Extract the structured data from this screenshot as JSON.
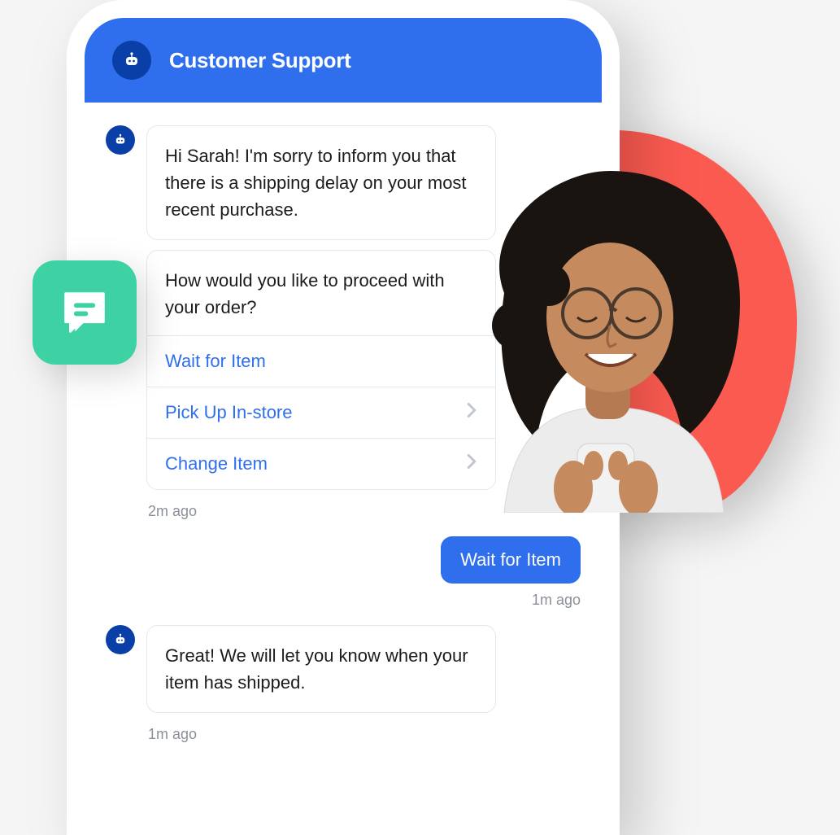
{
  "header": {
    "title": "Customer Support"
  },
  "messages": [
    {
      "from": "bot",
      "text": "Hi Sarah! I'm sorry to inform you that there is a shipping delay on your most recent purchase."
    },
    {
      "from": "bot",
      "question": "How would you like to proceed with your order?",
      "options": [
        {
          "label": "Wait for Item",
          "chevron": false
        },
        {
          "label": "Pick Up In-store",
          "chevron": true
        },
        {
          "label": "Change Item",
          "chevron": true
        }
      ],
      "timestamp": "2m ago"
    },
    {
      "from": "user",
      "text": "Wait for Item",
      "timestamp": "1m ago"
    },
    {
      "from": "bot",
      "text": "Great! We will let you know when your item has shipped.",
      "timestamp": "1m ago"
    }
  ]
}
